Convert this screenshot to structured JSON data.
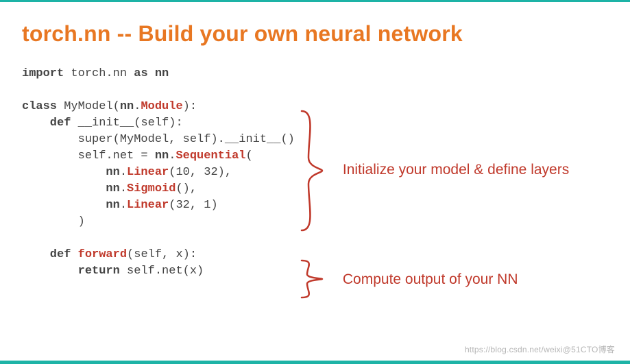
{
  "title": "torch.nn -- Build your own neural network",
  "code": {
    "l1a": "import ",
    "l1b": "torch.nn ",
    "l1c": "as ",
    "l1d": "nn",
    "l2a": "class ",
    "l2b": "MyModel(",
    "l2c": "nn",
    "l2d": ".",
    "l2e": "Module",
    "l2f": "):",
    "l3a": "    def ",
    "l3b": "__init__",
    "l3c": "(self):",
    "l4": "        super(MyModel, self).__init__()",
    "l5a": "        self.net = ",
    "l5b": "nn",
    "l5c": ".",
    "l5d": "Sequential",
    "l5e": "(",
    "l6a": "            ",
    "l6b": "nn",
    "l6c": ".",
    "l6d": "Linear",
    "l6e": "(10, 32),",
    "l7a": "            ",
    "l7b": "nn",
    "l7c": ".",
    "l7d": "Sigmoid",
    "l7e": "(),",
    "l8a": "            ",
    "l8b": "nn",
    "l8c": ".",
    "l8d": "Linear",
    "l8e": "(32, 1)",
    "l9": "        )",
    "l10a": "    def ",
    "l10b": "forward",
    "l10c": "(self, x):",
    "l11a": "        return ",
    "l11b": "self.net(x)"
  },
  "annotations": {
    "init": "Initialize your model & define layers",
    "forward": "Compute output of your NN"
  },
  "watermark": "https://blog.csdn.net/weixi@51CTO博客"
}
